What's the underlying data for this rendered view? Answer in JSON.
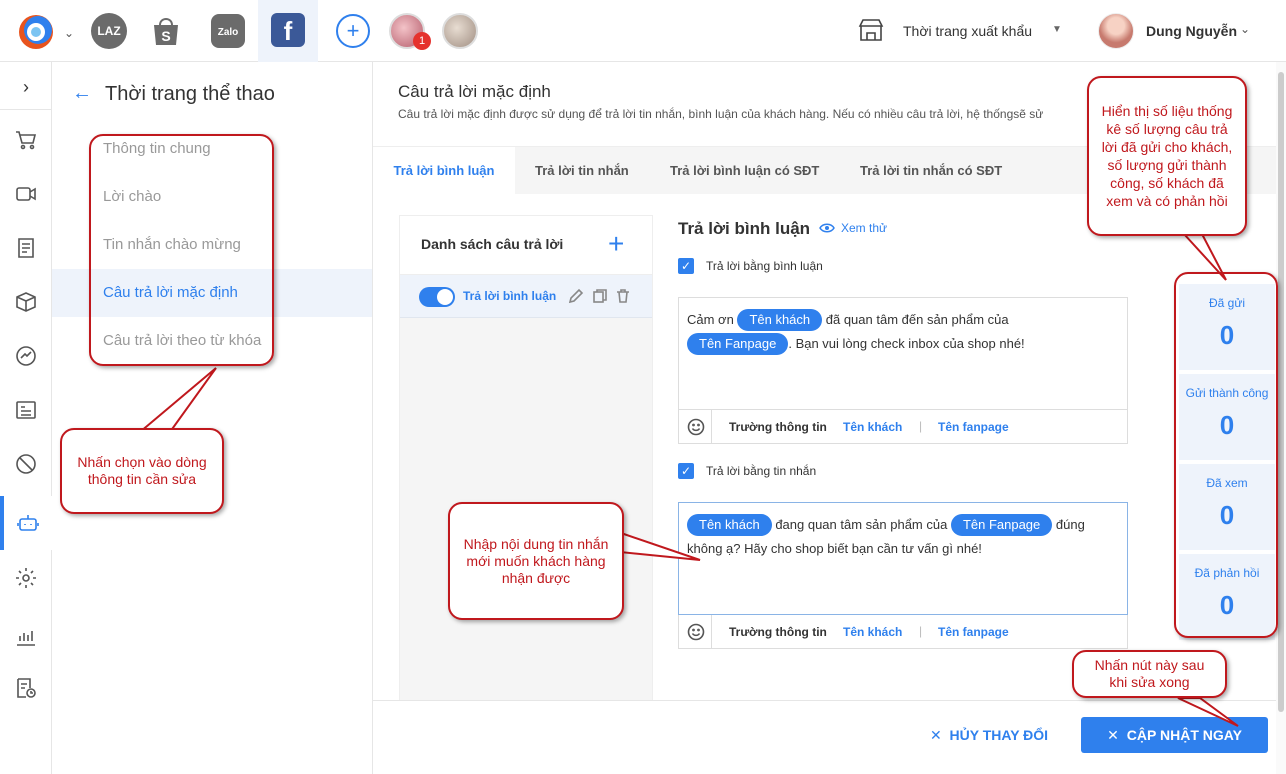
{
  "topbar": {
    "channels": [
      "LAZ",
      "S",
      "Zalo",
      "f"
    ],
    "add_label": "+",
    "notification_count": "1",
    "shop_name": "Thời trang xuất khẩu",
    "user_name": "Dung Nguyễn"
  },
  "rail": {
    "toggle": "›",
    "icons": [
      "cart-icon",
      "video-icon",
      "orders-icon",
      "box-icon",
      "messenger-icon",
      "post-icon",
      "block-icon",
      "bot-icon",
      "settings-icon",
      "chart-icon",
      "report-icon"
    ]
  },
  "menu": {
    "title": "Thời trang thể thao",
    "items": [
      {
        "label": "Thông tin chung"
      },
      {
        "label": "Lời chào"
      },
      {
        "label": "Tin nhắn chào mừng"
      },
      {
        "label": "Câu trả lời mặc định"
      },
      {
        "label": "Câu trả lời theo từ khóa"
      }
    ]
  },
  "main": {
    "title": "Câu trả lời mặc định",
    "description": "Câu trả lời mặc định được sử dụng để trả lời tin nhắn, bình luận của khách hàng. Nếu có nhiều câu trả lời, hệ thốngsẽ sử",
    "tabs": [
      {
        "label": "Trả lời bình luận"
      },
      {
        "label": "Trả lời tin nhắn"
      },
      {
        "label": "Trả lời bình luận có SĐT"
      },
      {
        "label": "Trả lời tin nhắn có SĐT"
      }
    ]
  },
  "list": {
    "title": "Danh sách câu trả lời",
    "add": "+",
    "rows": [
      {
        "label": "Trả lời bình luận"
      }
    ]
  },
  "editor": {
    "title": "Trả lời bình luận",
    "preview": "Xem thử",
    "comment": {
      "checkbox_label": "Trả lời bằng bình luận",
      "text_1": "Cảm ơn ",
      "chip_1": "Tên khách",
      "text_2": " đã quan tâm đến sản phẩm của",
      "chip_2": "Tên Fanpage",
      "text_3": ". Bạn vui lòng check inbox của shop nhé!"
    },
    "message": {
      "checkbox_label": "Trả lời bằng tin nhắn",
      "chip_1": "Tên khách",
      "text_1": " đang quan tâm sản phẩm của ",
      "chip_2": "Tên Fanpage",
      "text_2": " đúng không ạ? Hãy cho shop biết bạn cần tư vấn gì nhé!"
    },
    "fieldbar": {
      "label": "Trường thông tin",
      "link_1": "Tên khách",
      "separator": "|",
      "link_2": "Tên fanpage"
    }
  },
  "stats": [
    {
      "label": "Đã gửi",
      "value": "0"
    },
    {
      "label": "Gửi thành công",
      "value": "0"
    },
    {
      "label": "Đã xem",
      "value": "0"
    },
    {
      "label": "Đã phản hồi",
      "value": "0"
    }
  ],
  "footer": {
    "cancel": "HỦY THAY ĐỔI",
    "save": "CẬP NHẬT NGAY"
  },
  "annotations": {
    "menu_note": "Nhấn chọn vào dòng thông tin cần sửa",
    "editor_note": "Nhập nội dung tin nhắn mới muốn khách hàng nhận được",
    "stats_note": "Hiển thị số liệu thống kê số lượng câu trả lời đã gửi cho khách, số lượng gửi thành công, số khách đã xem và có phản hồi",
    "save_note": "Nhấn nút này sau khi sửa xong"
  },
  "colors": {
    "accent": "#2f80ed",
    "active_bg": "#eef3fb",
    "annotation": "#c0181d"
  }
}
